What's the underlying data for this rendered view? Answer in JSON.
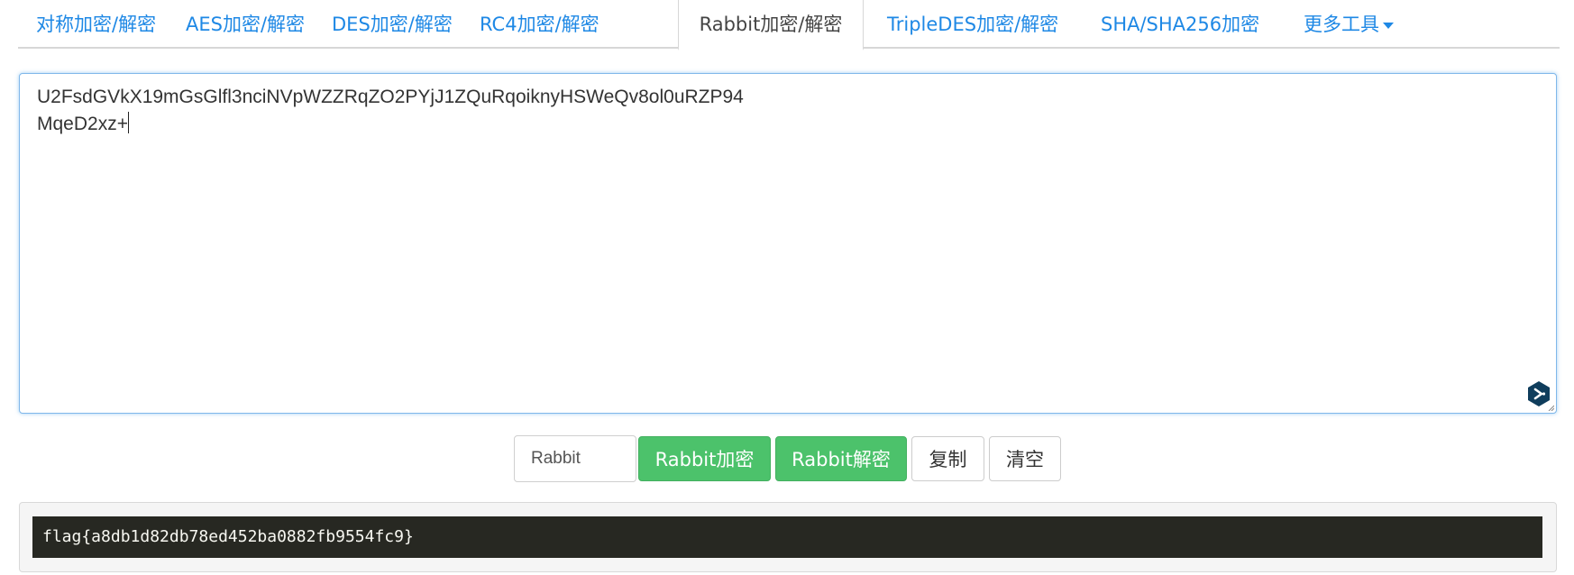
{
  "tabs": [
    {
      "label": "对称加密/解密",
      "active": false
    },
    {
      "label": "AES加密/解密",
      "active": false
    },
    {
      "label": "DES加密/解密",
      "active": false
    },
    {
      "label": "RC4加密/解密",
      "active": false
    },
    {
      "label": "Rabbit加密/解密",
      "active": true
    },
    {
      "label": "TripleDES加密/解密",
      "active": false
    },
    {
      "label": "SHA/SHA256加密",
      "active": false
    },
    {
      "label": "更多工具",
      "active": false
    }
  ],
  "editor": {
    "line1": "U2FsdGVkX19mGsGlfl3nciNVpWZZRqZO2PYjJ1ZQuRqoiknyHSWeQv8ol0uRZP94",
    "line2": "MqeD2xz+"
  },
  "controls": {
    "key_value": "Rabbit",
    "encrypt_label": "Rabbit加密",
    "decrypt_label": "Rabbit解密",
    "copy_label": "复制",
    "clear_label": "清空"
  },
  "output": {
    "text": "flag{a8db1d82db78ed452ba0882fb9554fc9}"
  },
  "colors": {
    "link": "#1e88e5",
    "button_green": "#4cc26b",
    "output_bg": "#272822"
  },
  "icons": {
    "more_tools_caret": "caret-down-icon",
    "editor_extension": "extension-icon"
  }
}
